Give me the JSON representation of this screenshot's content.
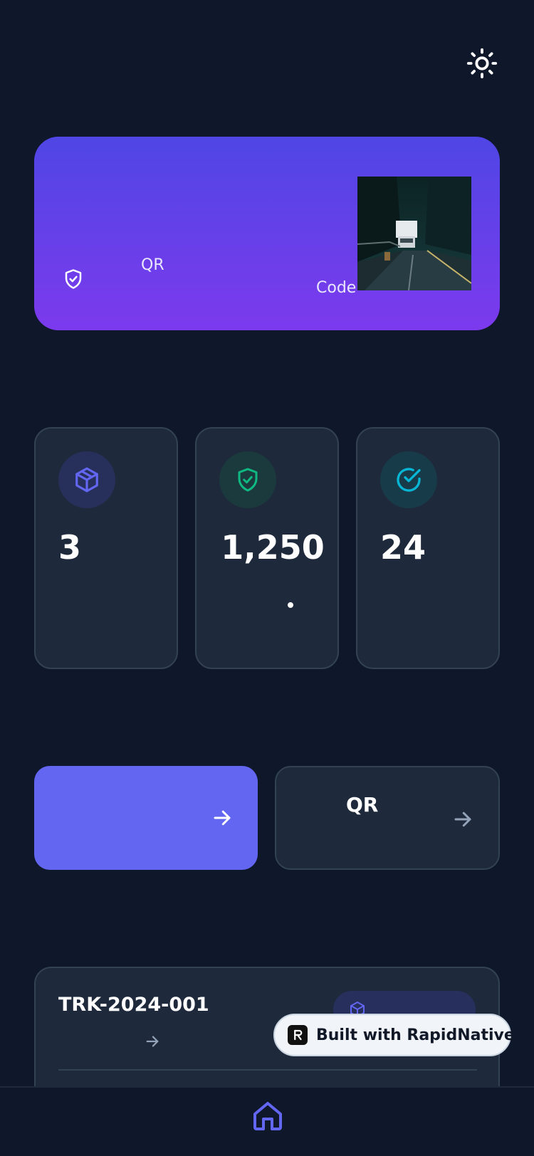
{
  "header": {
    "theme_toggle_icon": "sun-icon"
  },
  "hero": {
    "shield_icon": "shield-check-icon",
    "qr_label": "QR",
    "code_label": "Code",
    "image": "truck-on-road-photo",
    "gradient_top": "#4f46e5",
    "gradient_bottom": "#7c3aed"
  },
  "stats": [
    {
      "icon": "package-icon",
      "value": "3",
      "icon_color": "#6366f1"
    },
    {
      "icon": "shield-check-icon",
      "value": "1,250",
      "icon_color": "#10b981"
    },
    {
      "icon": "check-circle-icon",
      "value": "24",
      "icon_color": "#06b6d4"
    }
  ],
  "actions": {
    "primary": {
      "label": "",
      "icon": "arrow-right-icon",
      "color": "#6366f1"
    },
    "secondary": {
      "label": "QR",
      "icon": "arrow-right-icon"
    }
  },
  "shipment": {
    "id": "TRK-2024-001",
    "arrow_icon": "arrow-right-icon",
    "badge_icon": "package-icon"
  },
  "built_badge": {
    "text": "Built with RapidNative"
  },
  "nav": {
    "home_icon": "home-icon",
    "accent": "#6366f1"
  }
}
